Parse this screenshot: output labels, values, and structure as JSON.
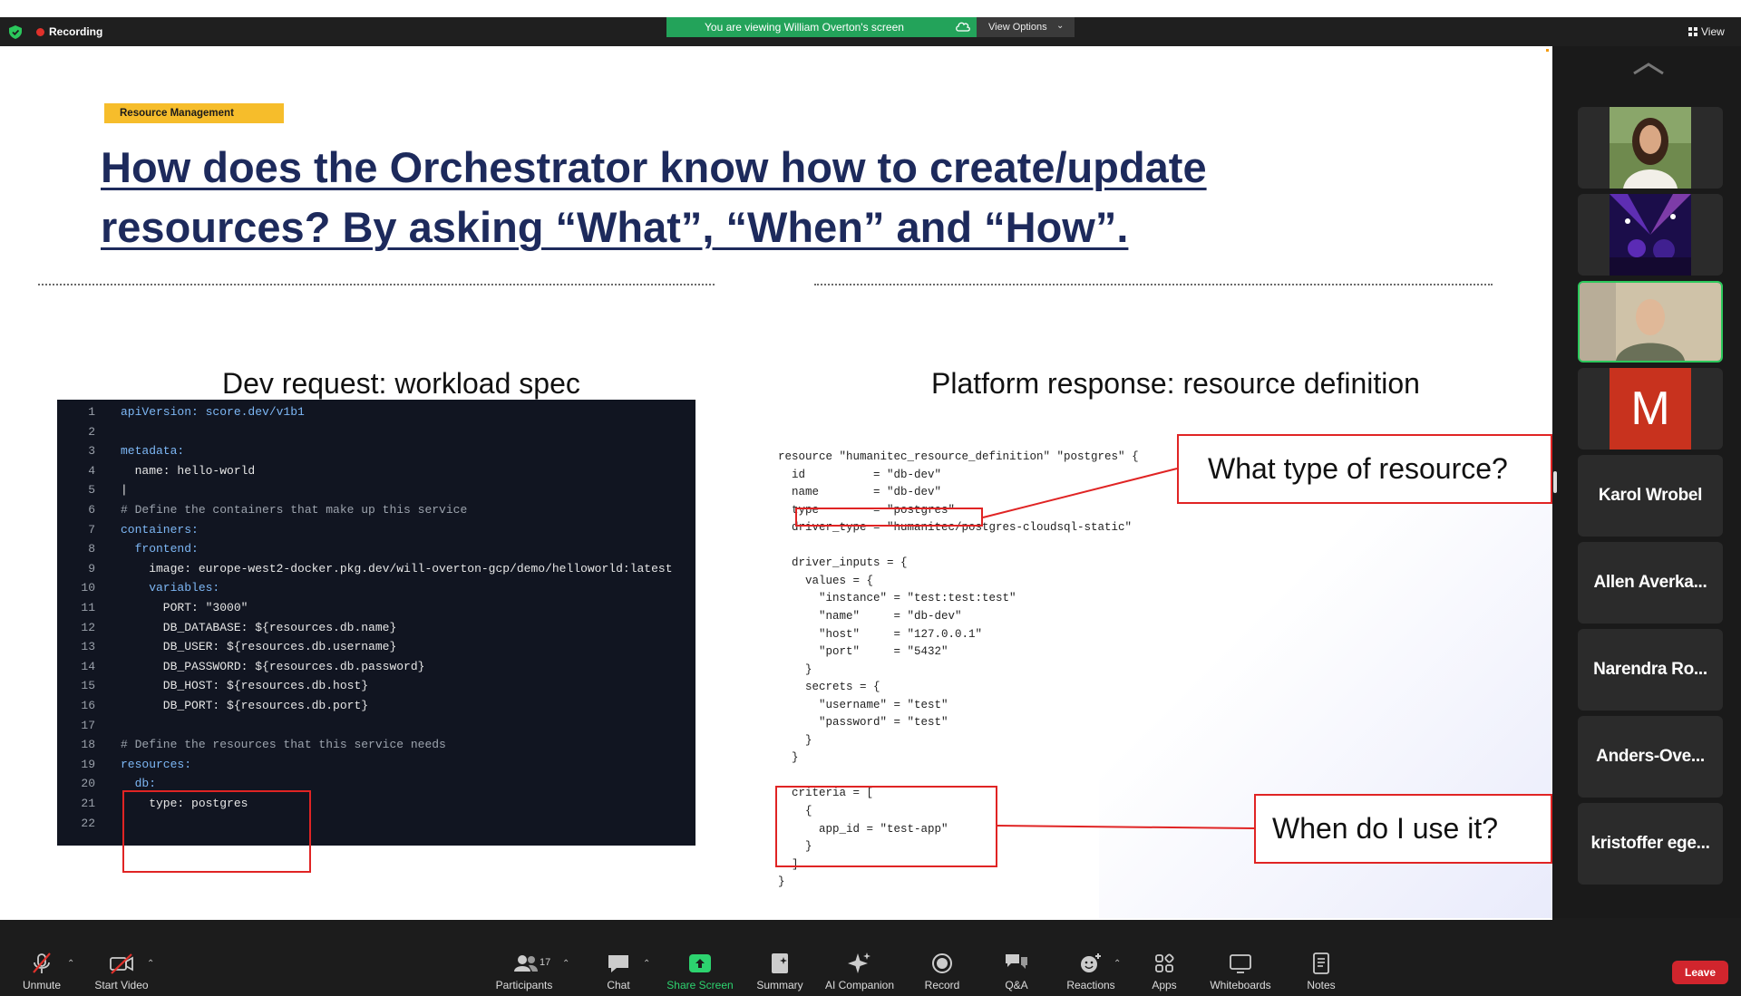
{
  "top_bar": {
    "recording_label": "Recording",
    "viewing_banner": "You are viewing William Overton's screen",
    "view_options_label": "View Options",
    "view_label": "View"
  },
  "slide": {
    "tag": "Resource Management",
    "title": "How does the Orchestrator know how to create/update resources? By asking “What”, “When” and “How”.",
    "heading_left": "Dev request: workload spec",
    "heading_right": "Platform response: resource definition",
    "callout_what": "What type of resource?",
    "callout_when": "When do I use it?",
    "left_code": [
      {
        "n": "1",
        "t": "apiVersion: score.dev/v1b1"
      },
      {
        "n": "2",
        "t": ""
      },
      {
        "n": "3",
        "t": "metadata:"
      },
      {
        "n": "4",
        "t": "  name: hello-world"
      },
      {
        "n": "5",
        "t": "|"
      },
      {
        "n": "6",
        "t": "# Define the containers that make up this service"
      },
      {
        "n": "7",
        "t": "containers:"
      },
      {
        "n": "8",
        "t": "  frontend:"
      },
      {
        "n": "9",
        "t": "    image: europe-west2-docker.pkg.dev/will-overton-gcp/demo/helloworld:latest"
      },
      {
        "n": "10",
        "t": "    variables:"
      },
      {
        "n": "11",
        "t": "      PORT: \"3000\""
      },
      {
        "n": "12",
        "t": "      DB_DATABASE: ${resources.db.name}"
      },
      {
        "n": "13",
        "t": "      DB_USER: ${resources.db.username}"
      },
      {
        "n": "14",
        "t": "      DB_PASSWORD: ${resources.db.password}"
      },
      {
        "n": "15",
        "t": "      DB_HOST: ${resources.db.host}"
      },
      {
        "n": "16",
        "t": "      DB_PORT: ${resources.db.port}"
      },
      {
        "n": "17",
        "t": ""
      },
      {
        "n": "18",
        "t": "# Define the resources that this service needs"
      },
      {
        "n": "19",
        "t": "resources:"
      },
      {
        "n": "20",
        "t": "  db:"
      },
      {
        "n": "21",
        "t": "    type: postgres"
      },
      {
        "n": "22",
        "t": ""
      }
    ],
    "right_code": [
      "resource \"humanitec_resource_definition\" \"postgres\" {",
      "  id          = \"db-dev\"",
      "  name        = \"db-dev\"",
      "  type        = \"postgres\"",
      "  driver_type = \"humanitec/postgres-cloudsql-static\"",
      "",
      "  driver_inputs = {",
      "    values = {",
      "      \"instance\" = \"test:test:test\"",
      "      \"name\"     = \"db-dev\"",
      "      \"host\"     = \"127.0.0.1\"",
      "      \"port\"     = \"5432\"",
      "    }",
      "    secrets = {",
      "      \"username\" = \"test\"",
      "      \"password\" = \"test\"",
      "    }",
      "  }",
      "",
      "  criteria = [",
      "    {",
      "      app_id = \"test-app\"",
      "    }",
      "  ]",
      "}"
    ]
  },
  "participants": {
    "tiles": [
      {
        "name": "Karol Wrobel"
      },
      {
        "name": "Allen Averka..."
      },
      {
        "name": "Narendra Ro..."
      },
      {
        "name": "Anders-Ove..."
      },
      {
        "name": "kristoffer ege..."
      }
    ],
    "avatar_letter": "M"
  },
  "toolbar": {
    "unmute": "Unmute",
    "start_video": "Start Video",
    "participants": "Participants",
    "participants_count": "17",
    "chat": "Chat",
    "share_screen": "Share Screen",
    "summary": "Summary",
    "ai_companion": "AI Companion",
    "record": "Record",
    "qa": "Q&A",
    "reactions": "Reactions",
    "apps": "Apps",
    "whiteboards": "Whiteboards",
    "notes": "Notes",
    "leave": "Leave"
  },
  "colors": {
    "banner_green": "#23a35a",
    "tag_yellow": "#f6bd2b",
    "title_navy": "#1d2a5c",
    "highlight_red": "#e02424",
    "leave_red": "#d1252d",
    "active_tile_green": "#2bc85c"
  }
}
